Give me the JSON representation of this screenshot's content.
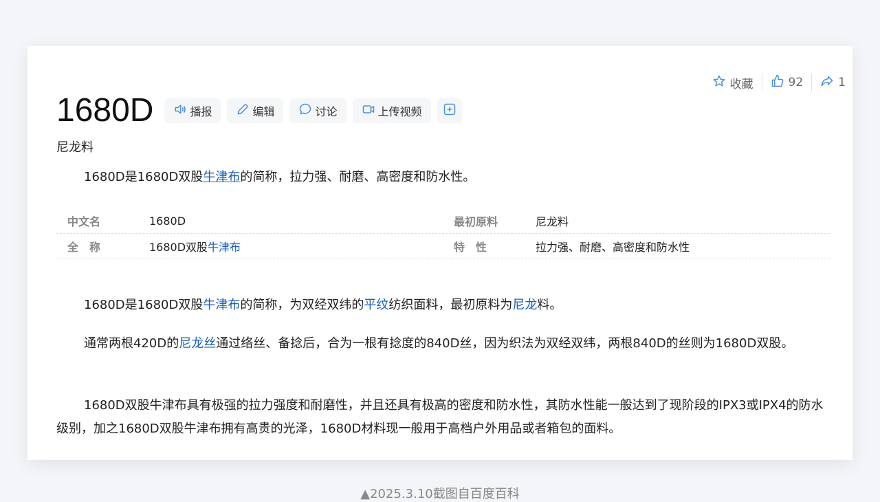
{
  "actions": {
    "collect_label": "收藏",
    "like_count": "92",
    "share_count": "1"
  },
  "title": "1680D",
  "toolbar": {
    "broadcast_label": "播报",
    "edit_label": "编辑",
    "discuss_label": "讨论",
    "upload_video_label": "上传视频"
  },
  "subtitle": "尼龙料",
  "summary": {
    "before": "1680D是1680D双股",
    "link": "牛津布",
    "after": "的简称，拉力强、耐磨、高密度和防水性。"
  },
  "info": [
    {
      "k1": "中文名",
      "v1": "1680D",
      "k2": "最初原料",
      "v2": "尼龙料"
    },
    {
      "k1": "全　称",
      "v1_before": "1680D双股",
      "v1_link": "牛津布",
      "k2": "特　性",
      "v2": "拉力强、耐磨、高密度和防水性"
    }
  ],
  "paragraphs": {
    "p1": {
      "a": "1680D是1680D双股",
      "l1": "牛津布",
      "b": "的简称，为双经双纬的",
      "l2": "平纹",
      "c": "纺织面料，最初原料为",
      "l3": "尼龙",
      "d": "料。"
    },
    "p2": {
      "a": "通常两根420D的",
      "l1": "尼龙丝",
      "b": "通过络丝、备捻后，合为一根有捻度的840D丝，因为织法为双经双纬，两根840D的丝则为1680D双股。"
    },
    "p3": "1680D双股牛津布具有极强的拉力强度和耐磨性，并且还具有极高的密度和防水性，其防水性能一般达到了现阶段的IPX3或IPX4的防水级别，加之1680D双股牛津布拥有高贵的光泽，1680D材料现一般用于高档户外用品或者箱包的面料。"
  },
  "caption": "▲2025.3.10截图自百度百科",
  "colors": {
    "link": "#1a5fb4",
    "icon": "#4a8fe0",
    "muted": "#888888"
  }
}
